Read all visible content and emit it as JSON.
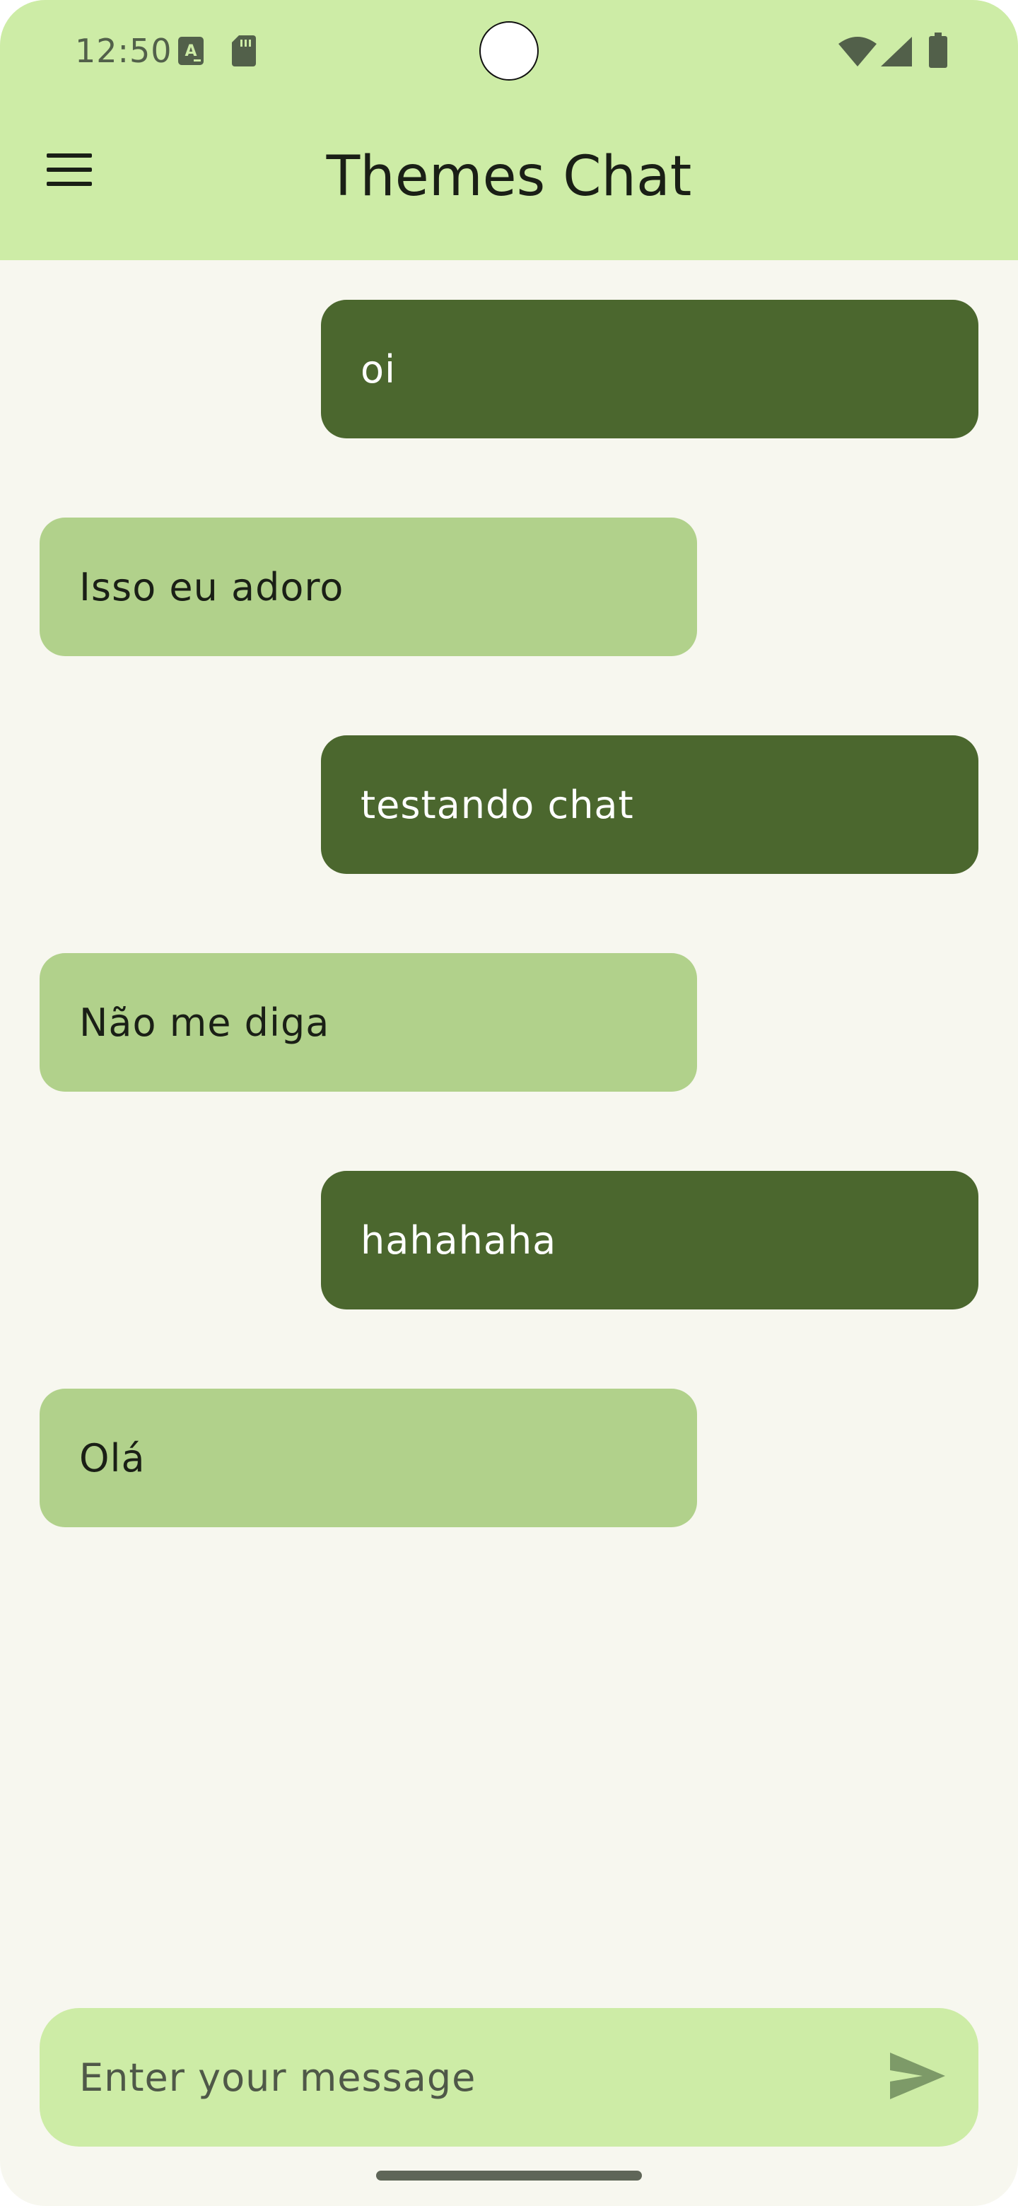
{
  "status_bar": {
    "time": "12:50",
    "icons": [
      "translate-a-icon",
      "sd-card-icon",
      "wifi-icon",
      "cell-signal-icon",
      "battery-icon"
    ]
  },
  "app_bar": {
    "title": "Themes Chat",
    "menu_icon": "hamburger-menu-icon"
  },
  "messages": [
    {
      "text": "oi",
      "direction": "sent"
    },
    {
      "text": "Isso eu adoro",
      "direction": "received"
    },
    {
      "text": "testando chat",
      "direction": "sent"
    },
    {
      "text": "Não me diga",
      "direction": "received"
    },
    {
      "text": "hahahaha",
      "direction": "sent"
    },
    {
      "text": "Olá",
      "direction": "received"
    }
  ],
  "composer": {
    "placeholder": "Enter your message",
    "value": "",
    "send_icon": "send-icon"
  },
  "colors": {
    "top_bar": "#cdeca6",
    "background": "#f7f7ef",
    "sent_bubble": "#4b672e",
    "received_bubble": "#b1d18b",
    "composer": "#cdeca6",
    "title_text": "#1a1f16"
  }
}
